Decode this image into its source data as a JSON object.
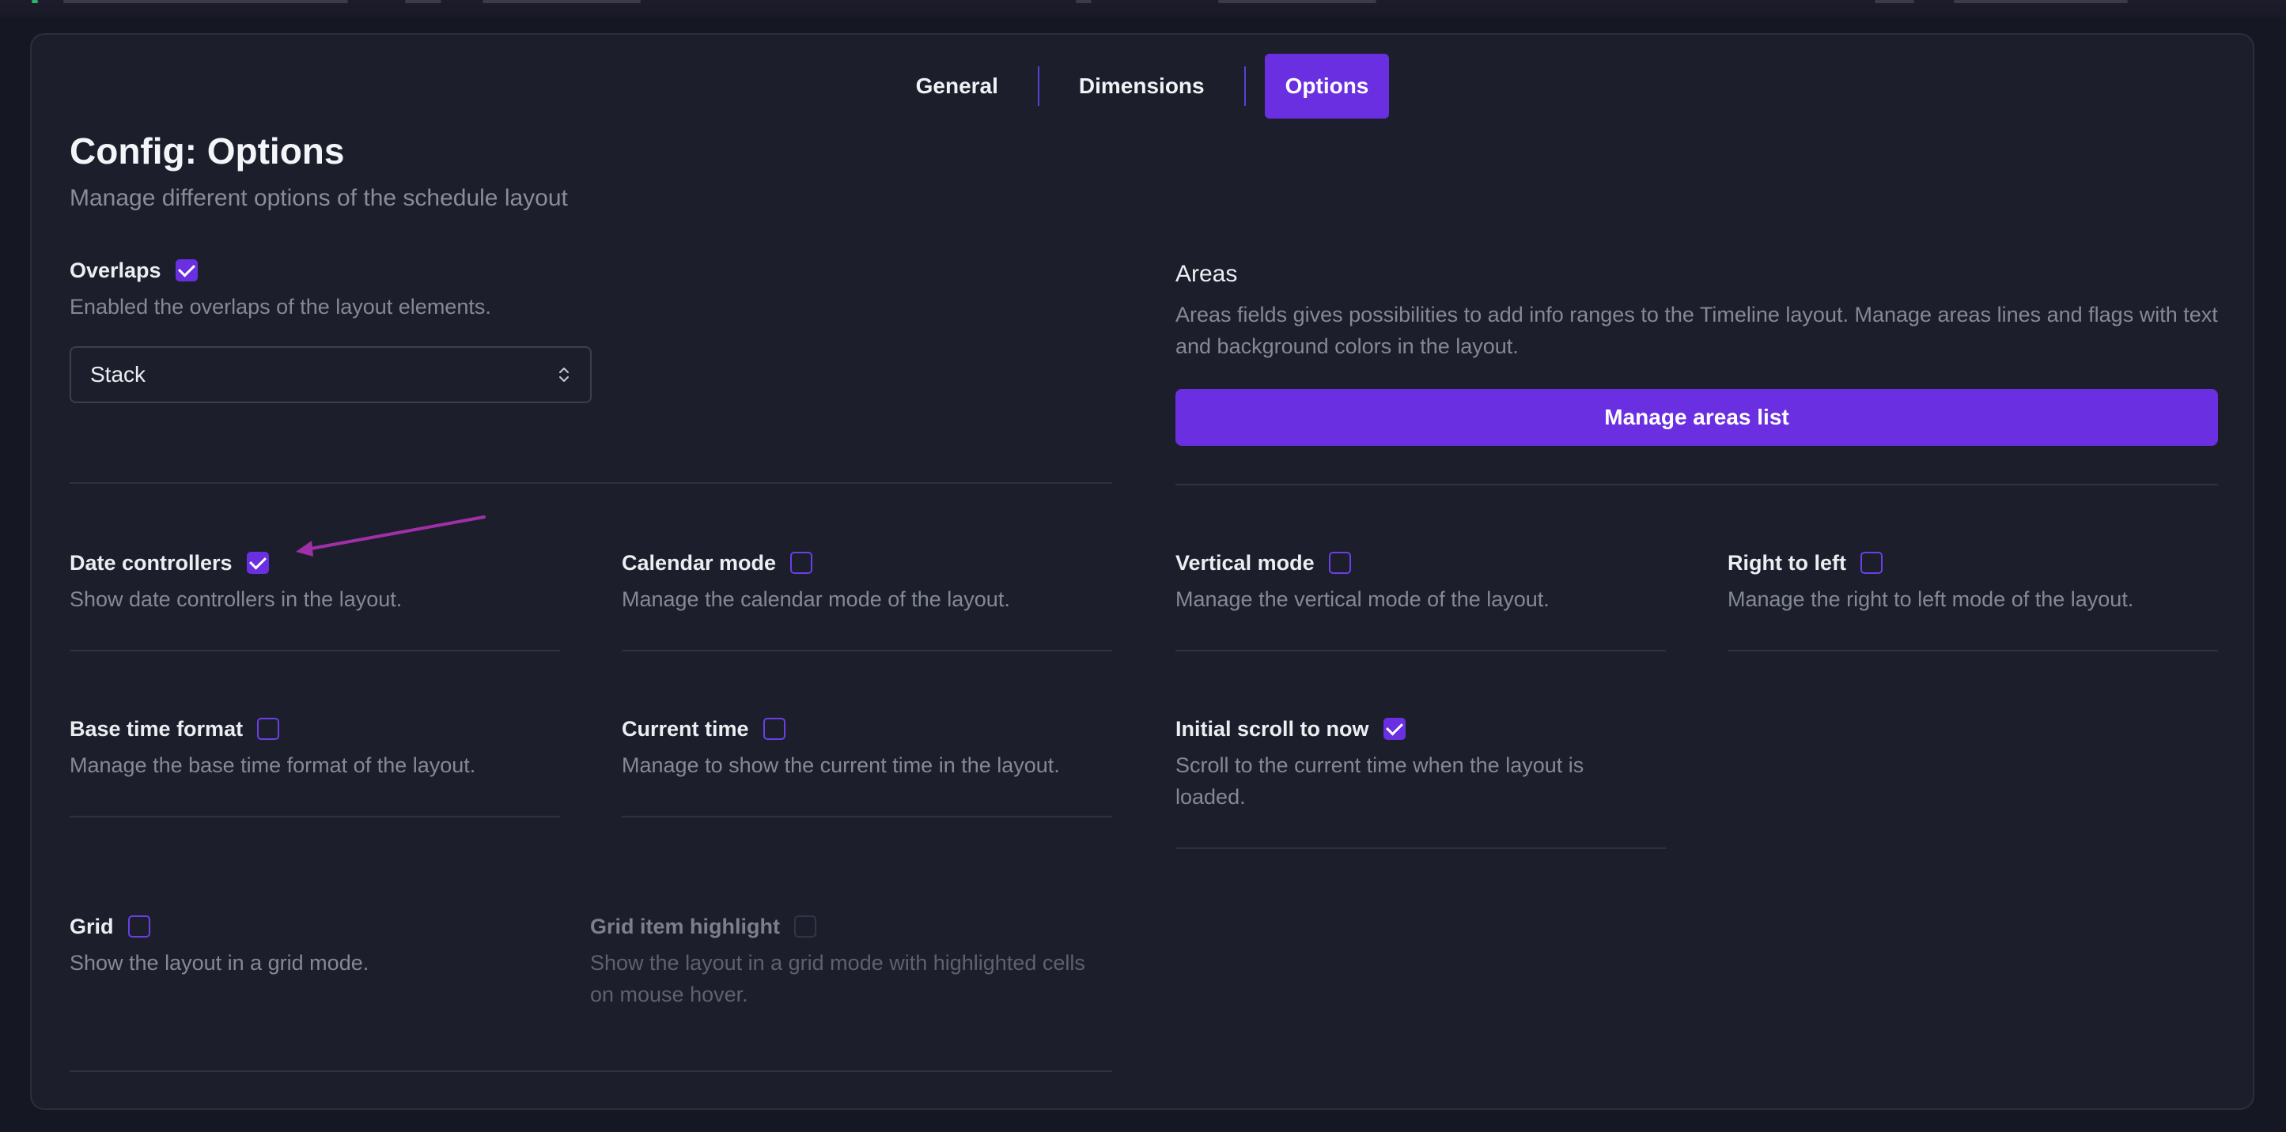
{
  "tabs": [
    {
      "label": "General",
      "active": false
    },
    {
      "label": "Dimensions",
      "active": false
    },
    {
      "label": "Options",
      "active": true
    }
  ],
  "header": {
    "title": "Config: Options",
    "subtitle": "Manage different options of the schedule layout"
  },
  "overlaps": {
    "label": "Overlaps",
    "checked": true,
    "description": "Enabled the overlaps of the layout elements.",
    "select_value": "Stack"
  },
  "areas": {
    "title": "Areas",
    "description": "Areas fields gives possibilities to add info ranges to the Timeline layout. Manage areas lines and flags with text and background colors in the layout.",
    "button_label": "Manage areas list"
  },
  "options": [
    {
      "label": "Date controllers",
      "checked": true,
      "description": "Show date controllers in the layout."
    },
    {
      "label": "Calendar mode",
      "checked": false,
      "description": "Manage the calendar mode of the layout."
    },
    {
      "label": "Vertical mode",
      "checked": false,
      "description": "Manage the vertical mode of the layout."
    },
    {
      "label": "Right to left",
      "checked": false,
      "description": "Manage the right to left mode of the layout."
    },
    {
      "label": "Base time format",
      "checked": false,
      "description": "Manage the base time format of the layout."
    },
    {
      "label": "Current time",
      "checked": false,
      "description": "Manage to show the current time in the layout."
    },
    {
      "label": "Initial scroll to now",
      "checked": true,
      "description": "Scroll to the current time when the layout is loaded."
    },
    {
      "label": "Grid",
      "checked": false,
      "description": "Show the layout in a grid mode."
    },
    {
      "label": "Grid item highlight",
      "checked": false,
      "disabled": true,
      "description": "Show the layout in a grid mode with highlighted cells on mouse hover."
    }
  ],
  "colors": {
    "accent": "#6a2fe0",
    "background": "#151722",
    "panel": "#1c1f2b",
    "annotation_arrow": "#a02fa8"
  }
}
